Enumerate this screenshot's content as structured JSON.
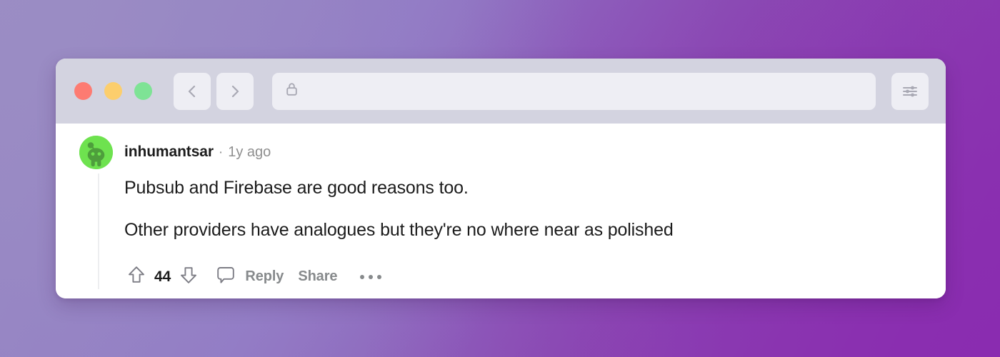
{
  "background": {
    "gradient_from": "#9b8dc4",
    "gradient_to": "#8a2fae"
  },
  "browser": {
    "traffic_lights": [
      {
        "name": "close",
        "color": "#fd7b72"
      },
      {
        "name": "minimize",
        "color": "#fcce6d"
      },
      {
        "name": "maximize",
        "color": "#7ee395"
      }
    ],
    "back_button": "back-icon",
    "forward_button": "forward-icon",
    "address_bar": {
      "lock_icon": "lock-icon",
      "value": "",
      "placeholder": ""
    },
    "settings_button": "sliders-icon"
  },
  "comment": {
    "avatar": "reddit-snoo-avatar",
    "author": "inhumantsar",
    "separator": "·",
    "timestamp": "1y ago",
    "paragraphs": [
      "Pubsub and Firebase are good reasons too.",
      "Other providers have analogues but they're no where near as polished"
    ],
    "actions": {
      "upvote_icon": "upvote-arrow-icon",
      "score": "44",
      "downvote_icon": "downvote-arrow-icon",
      "comment_icon": "comment-bubble-icon",
      "reply_label": "Reply",
      "share_label": "Share",
      "more_label": "•••"
    }
  }
}
